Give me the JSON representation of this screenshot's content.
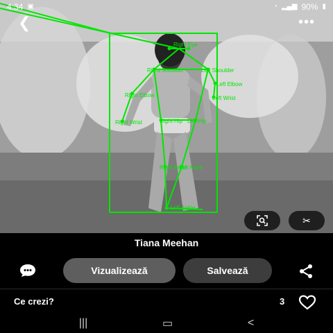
{
  "status_bar": {
    "time": "4:34",
    "battery": "90%"
  },
  "photo": {
    "subject": "runway model with pose keypoint overlay",
    "overlay_color": "#00e600",
    "keypoint_labels": [
      "Right Eye",
      "Right Shoulder",
      "Left Shoulder",
      "Left Elbow",
      "Left Wrist",
      "Right Elbow",
      "Right Wrist",
      "Right Hip",
      "Left Hip",
      "Right Knee",
      "Left Knee",
      "Left Ankle"
    ]
  },
  "pin": {
    "title": "Tiana Meehan"
  },
  "actions": {
    "view_label": "Vizualizează",
    "save_label": "Salvează"
  },
  "comments": {
    "label": "Ce crezi?",
    "reaction_count": "3"
  },
  "icons": [
    "back-icon",
    "more-icon",
    "lens-icon",
    "scissors-icon",
    "comment-icon",
    "share-icon",
    "heart-icon"
  ]
}
